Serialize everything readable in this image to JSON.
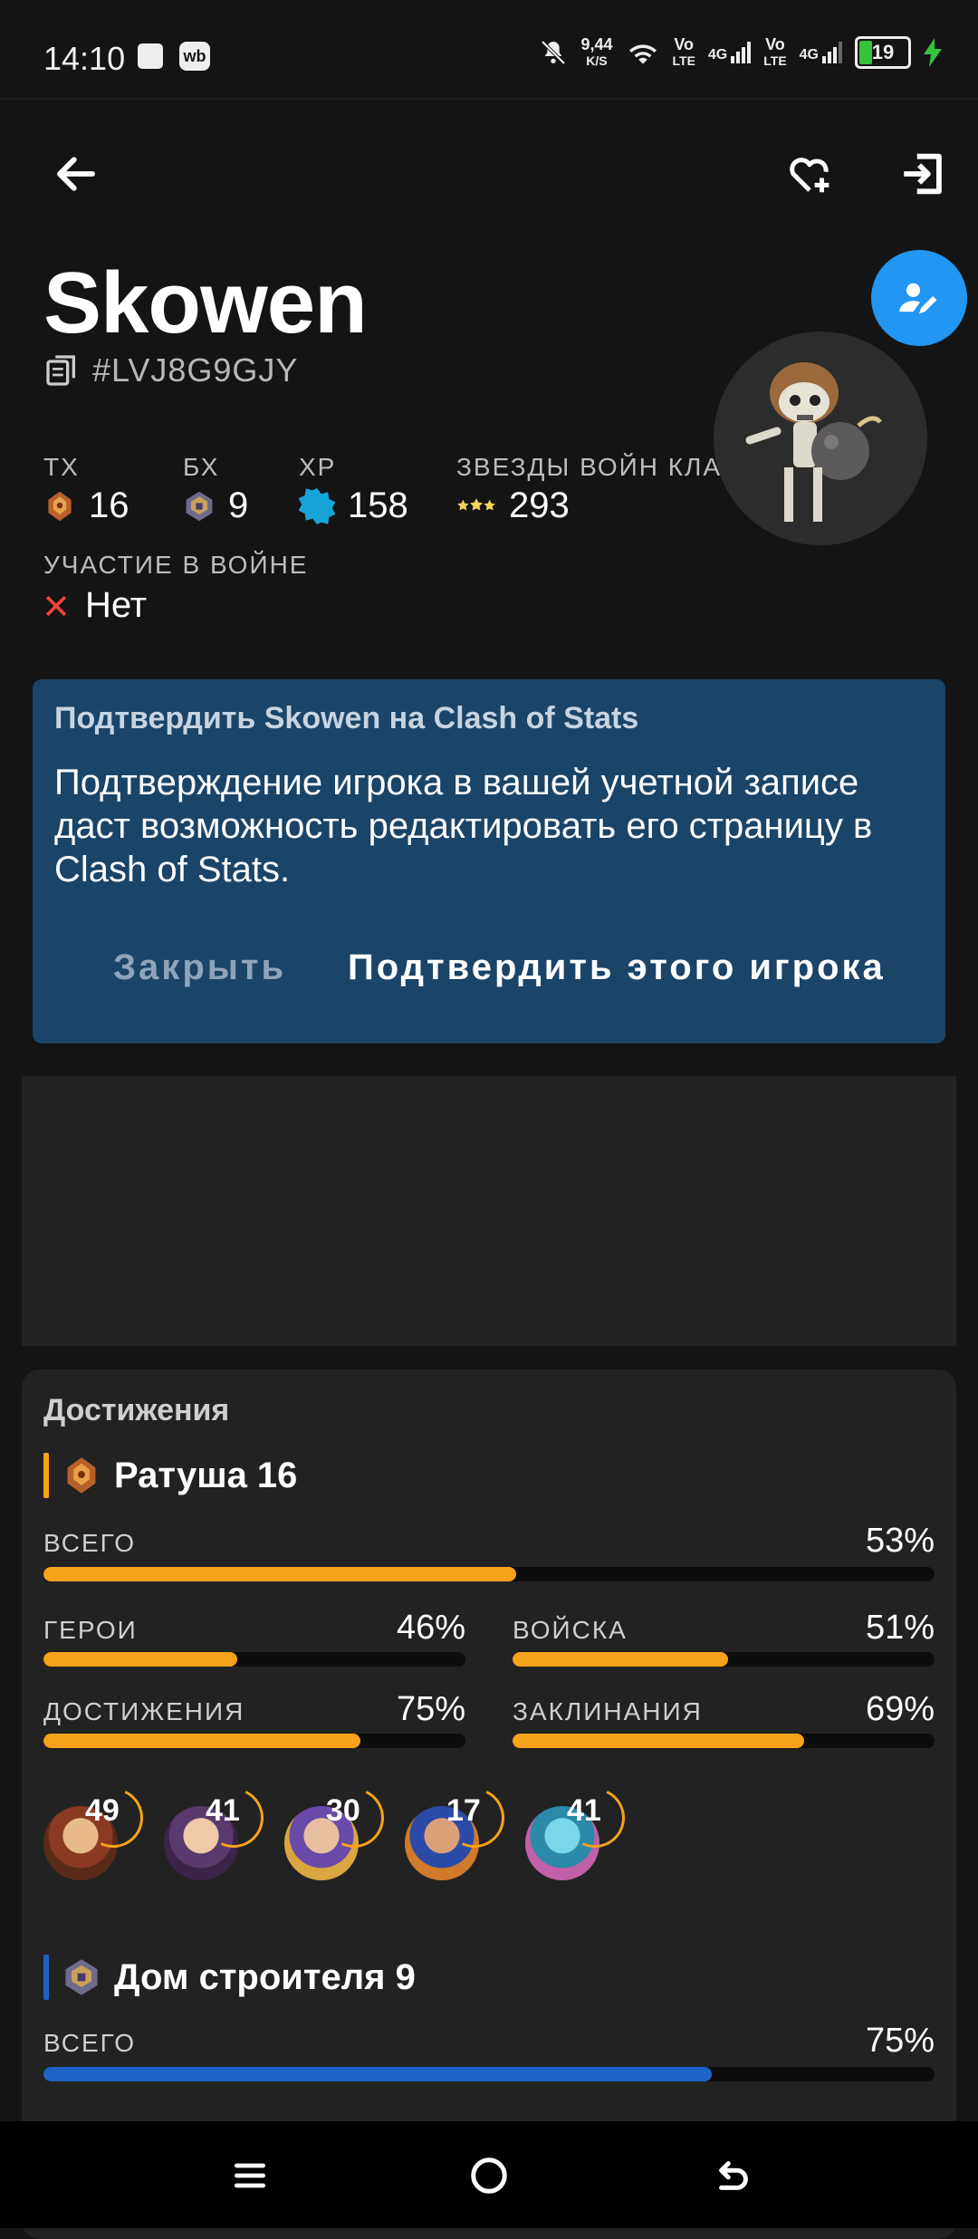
{
  "status_bar": {
    "time": "14:10",
    "speed_value": "9,44",
    "speed_unit": "K/S",
    "sim1_label_top": "Vo",
    "sim1_label_bottom": "LTE",
    "sim1_net": "4G",
    "sim2_label_top": "Vo",
    "sim2_label_bottom": "LTE",
    "sim2_net": "4G",
    "battery": "19"
  },
  "player": {
    "name": "Skowen",
    "tag": "#LVJ8G9GJY",
    "stats": [
      {
        "label": "ТХ",
        "value": "16"
      },
      {
        "label": "БХ",
        "value": "9"
      },
      {
        "label": "XP",
        "value": "158"
      },
      {
        "label": "ЗВЕЗДЫ ВОЙН КЛА",
        "value": "293"
      }
    ],
    "war_label": "УЧАСТИЕ В ВОЙНЕ",
    "war_value": "Нет"
  },
  "verify_card": {
    "title": "Подтвердить Skowen на Clash of Stats",
    "body": "Подтверждение игрока в вашей учетной записе даст возможность редактировать его страницу в Clash of Stats.",
    "close_label": "Закрыть",
    "confirm_label": "Подтвердить этого игрока"
  },
  "achievements": {
    "title": "Достижения",
    "town_hall": {
      "title": "Ратуша 16",
      "total_label": "ВСЕГО",
      "total": 53,
      "total_text": "53%",
      "heroes_label": "ГЕРОИ",
      "heroes": 46,
      "heroes_text": "46%",
      "troops_label": "ВОЙСКА",
      "troops": 51,
      "troops_text": "51%",
      "achievements_label": "ДОСТИЖЕНИЯ",
      "achievements": 75,
      "achievements_text": "75%",
      "spells_label": "ЗАКЛИНАНИЯ",
      "spells": 69,
      "spells_text": "69%",
      "hero_levels": [
        "49",
        "41",
        "30",
        "17",
        "41"
      ]
    },
    "builder_base": {
      "title": "Дом строителя 9",
      "total_label": "ВСЕГО",
      "total": 75,
      "total_text": "75%"
    }
  },
  "colors": {
    "accent_orange": "#f7a21b",
    "accent_blue": "#1e63c8",
    "fab_blue": "#2196f3",
    "card_blue": "#1a4468"
  }
}
